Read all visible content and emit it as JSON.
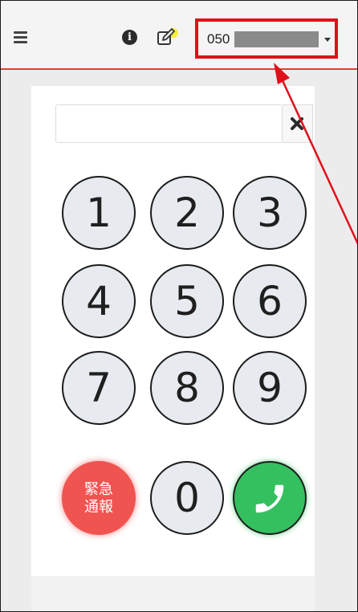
{
  "header": {
    "menu_icon": "hamburger-menu-icon",
    "info_icon": "info-circle-icon",
    "info_glyph": "i",
    "edit_icon": "pencil-square-icon",
    "line_selector": {
      "value_prefix": "050",
      "caret_icon": "caret-down-icon"
    }
  },
  "dialer": {
    "number_input": {
      "value": "",
      "placeholder": ""
    },
    "clear_icon": "close-x-icon",
    "keys": {
      "k1": "1",
      "k2": "2",
      "k3": "3",
      "k4": "4",
      "k5": "5",
      "k6": "6",
      "k7": "7",
      "k8": "8",
      "k9": "9",
      "emergency_line1": "緊急",
      "emergency_line2": "通報",
      "k0": "0",
      "call_icon": "phone-icon"
    }
  },
  "colors": {
    "header_rule": "#e0403a",
    "highlight_box": "#e0101a",
    "emergency": "#ef5451",
    "call": "#35c060",
    "key_fill": "#e7ebef"
  }
}
